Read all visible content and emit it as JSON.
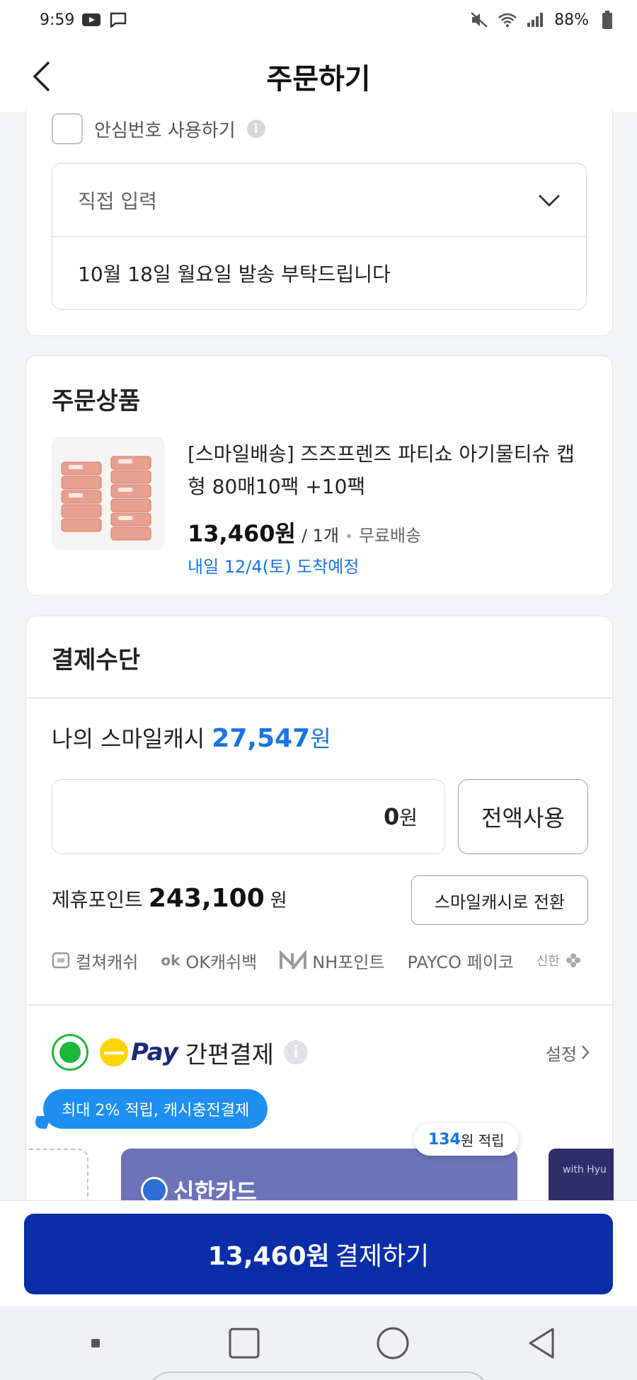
{
  "status_bar": {
    "time": "9:59",
    "battery": "88%"
  },
  "header": {
    "title": "주문하기"
  },
  "delivery_memo": {
    "safe_number_label": "안심번호 사용하기",
    "select_label": "직접 입력",
    "memo_text": "10월 18일 월요일 발송 부탁드립니다"
  },
  "order_product": {
    "section_title": "주문상품",
    "name": "[스마일배송] 즈즈프렌즈 파티쇼 아기물티슈 캡형 80매10팩 +10팩",
    "price": "13,460원",
    "quantity": "/ 1개",
    "shipping": "무료배송",
    "arrival": "내일 12/4(토) 도착예정"
  },
  "payment": {
    "section_title": "결제수단",
    "smilecash_label": "나의 스마일캐시",
    "smilecash_amount": "27,547",
    "smilecash_unit": "원",
    "input_value": "0",
    "input_unit": "원",
    "full_use_label": "전액사용",
    "points_label": "제휴포인트",
    "points_value": "243,100",
    "points_unit": "원",
    "convert_label": "스마일캐시로 전환",
    "partners": [
      {
        "logo": "culture-cash-icon",
        "label": "컬쳐캐쉬"
      },
      {
        "logo": "ok-cashbag-icon",
        "label": "OK캐쉬백"
      },
      {
        "logo": "nh-point-icon",
        "label": "NH포인트"
      },
      {
        "logo": "payco-icon",
        "label": "PAYCO 페이코"
      },
      {
        "logo": "shinhan-icon",
        "label": "신한"
      }
    ],
    "smilepay": {
      "pay_word": "Pay",
      "label": "간편결제",
      "settings_label": "설정",
      "promo": "최대 2% 적립, 캐시충전결제",
      "reward_amount": "134",
      "reward_unit": "원 적립",
      "card_name": "신한카드",
      "next_card_text": "with Hyu"
    }
  },
  "pay_button": {
    "amount": "13,460원",
    "label": "결제하기"
  },
  "colors": {
    "accent_blue": "#1a74e4",
    "pay_button": "#0a2ea8",
    "radio_green": "#1db83a",
    "promo_blue": "#1e8ff0",
    "card_purple": "#6c73b8"
  }
}
